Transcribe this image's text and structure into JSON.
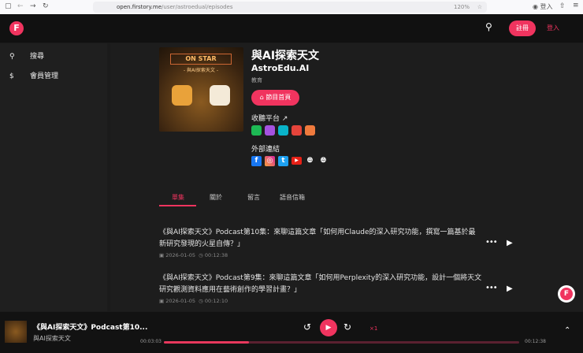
{
  "browser": {
    "url_host": "open.firstory.me",
    "url_path": "/user/astroedual/episodes",
    "zoom": "120%",
    "account_label": "登入"
  },
  "nav": {
    "logo": "F",
    "signup": "註冊",
    "login": "登入"
  },
  "sidebar": {
    "items": [
      {
        "icon": "search-icon",
        "label": "搜尋"
      },
      {
        "icon": "dollar-icon",
        "label": "會員管理"
      }
    ]
  },
  "show": {
    "title": "與AI探索天文",
    "author": "AstroEdu.AI",
    "category": "教育",
    "home_button": "節目首頁",
    "cover_text": "ON STAR",
    "cover_sub": "- 與AI探索天文 -",
    "platforms_label": "收聽平台",
    "platforms": [
      "spotify",
      "apple-podcasts",
      "kkbox",
      "pocket-casts",
      "rss"
    ],
    "links_label": "外部連結",
    "links": [
      "facebook",
      "instagram",
      "twitter",
      "youtube",
      "website",
      "website"
    ]
  },
  "colors": {
    "accent": "#f0345f"
  },
  "tabs": [
    {
      "label": "單集",
      "active": true
    },
    {
      "label": "關於"
    },
    {
      "label": "留言"
    },
    {
      "label": "語音信箱"
    }
  ],
  "episodes": [
    {
      "title": "《與AI探索天文》Podcast第10集：來聊這篇文章「如何用Claude的深入研究功能，撰寫一篇基於最新研究發現的火星自傳？」",
      "date": "2026-01-05",
      "duration": "00:12:38"
    },
    {
      "title": "《與AI探索天文》Podcast第9集：來聊這篇文章「如何用Perplexity的深入研究功能，設計一個將天文研究觀測資料應用在藝術創作的學習計畫？」",
      "date": "2026-01-05",
      "duration": "00:12:10"
    }
  ],
  "player": {
    "title": "《與AI探索天文》Podcast第10...",
    "show": "與AI探索天文",
    "speed": "×1",
    "current": "00:03:03",
    "total": "00:12:38",
    "progress_pct": 24
  }
}
